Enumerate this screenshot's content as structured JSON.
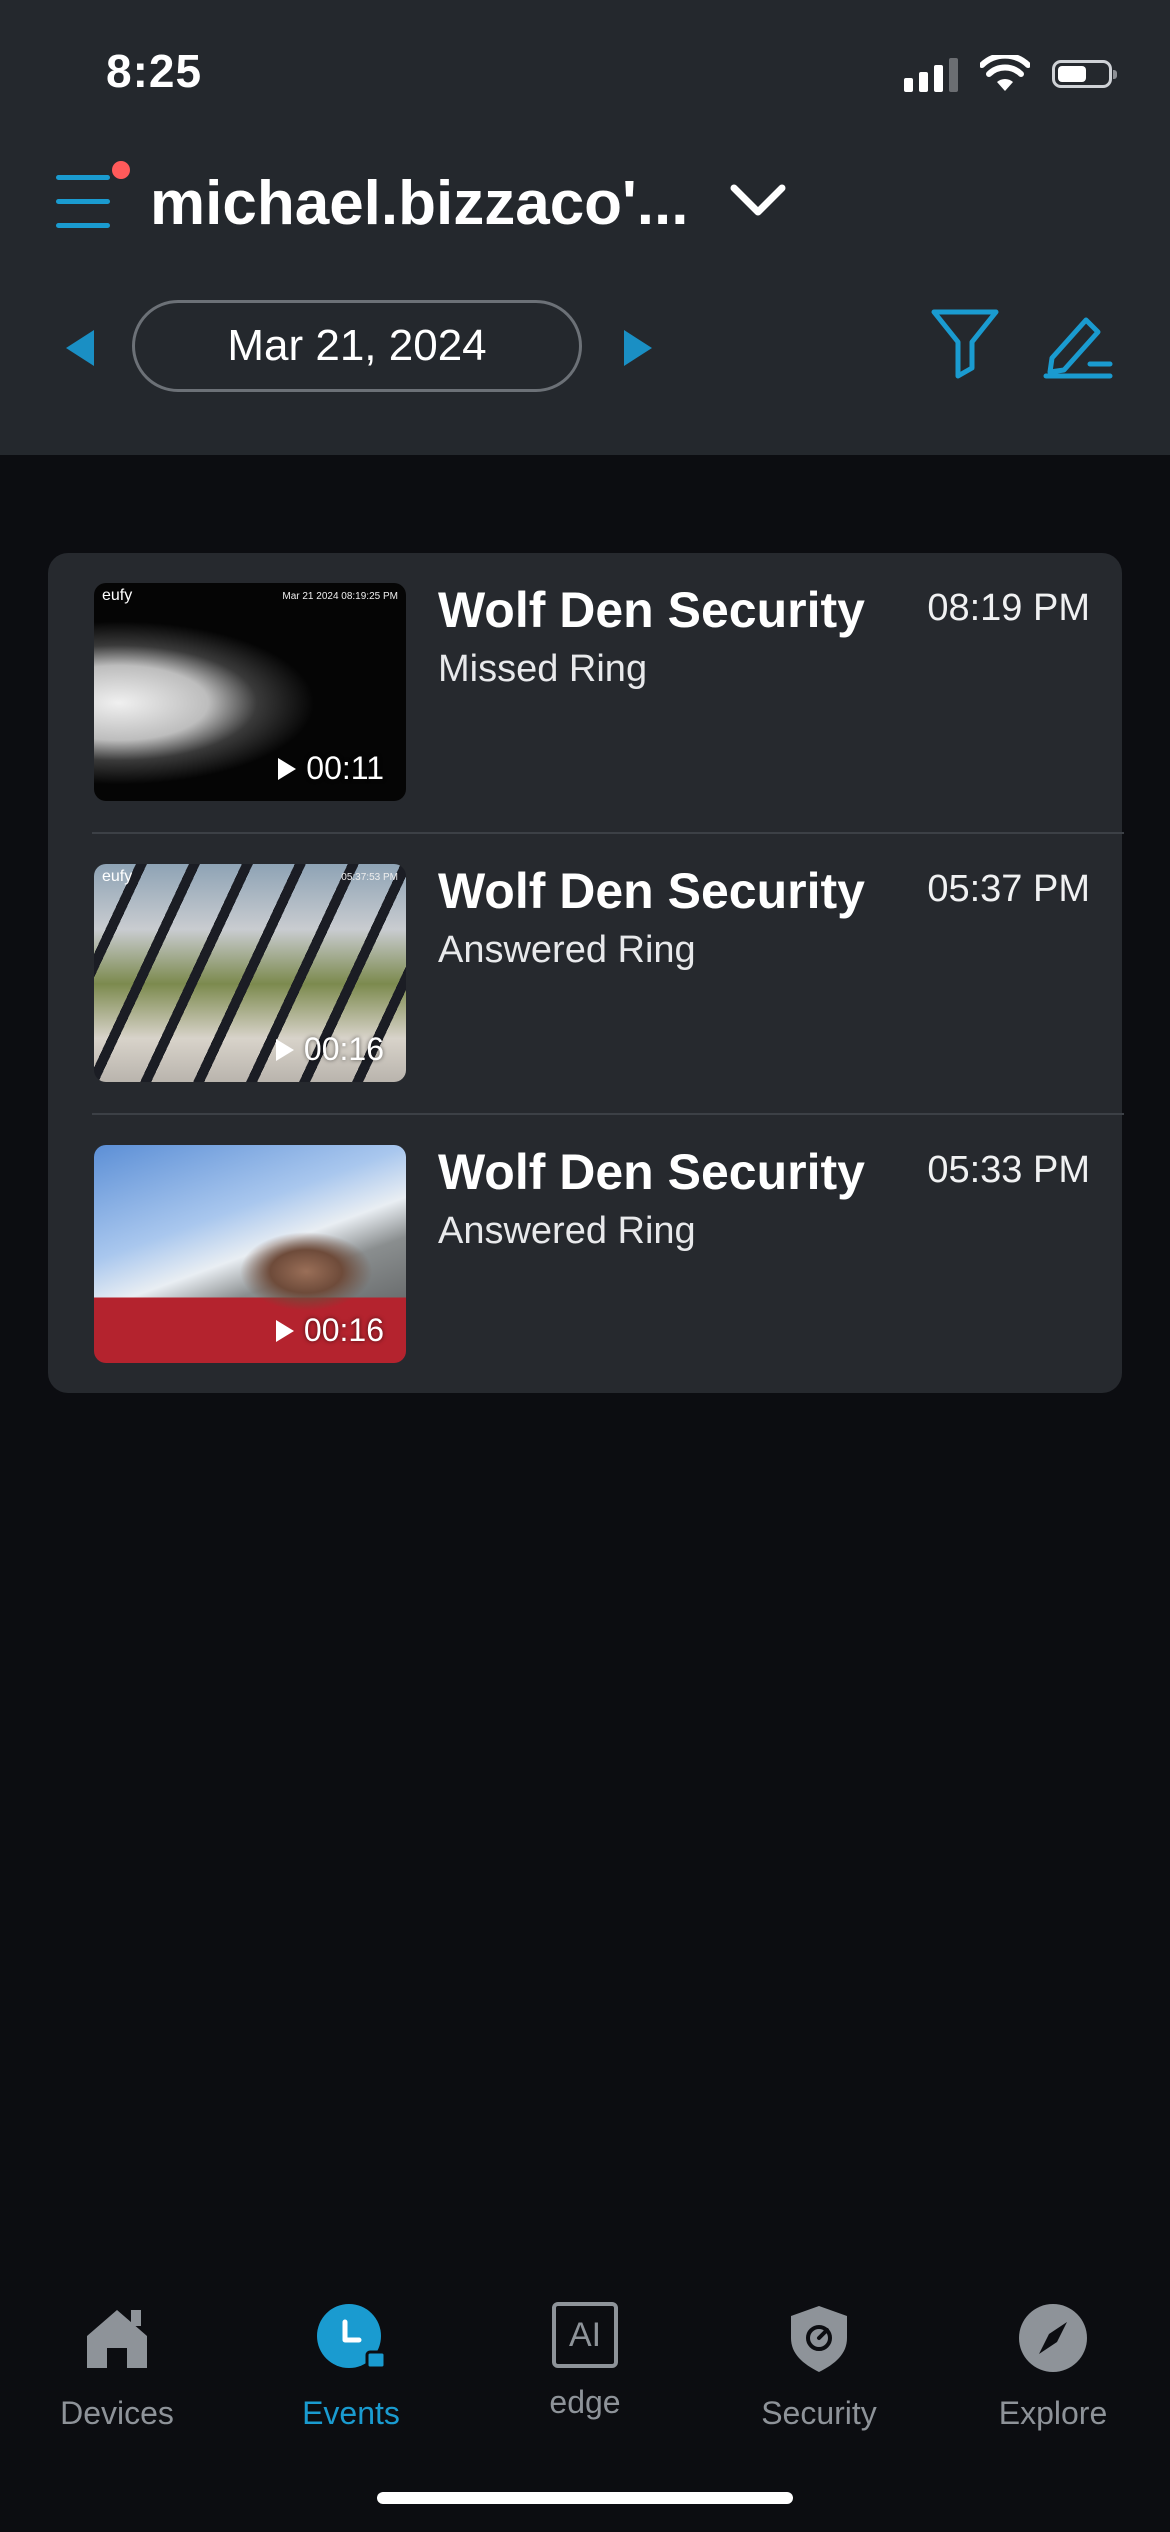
{
  "status_bar": {
    "time": "8:25"
  },
  "header": {
    "account_name": "michael.bizzaco'...",
    "date": "Mar 21, 2024"
  },
  "events": [
    {
      "title": "Wolf Den Security",
      "subtitle": "Missed Ring",
      "time": "08:19 PM",
      "duration": "00:11",
      "thumb_logo": "eufy",
      "thumb_stamp": "Mar 21 2024 08:19:25 PM"
    },
    {
      "title": "Wolf Den Security",
      "subtitle": "Answered Ring",
      "time": "05:37 PM",
      "duration": "00:16",
      "thumb_logo": "eufy",
      "thumb_stamp": "05:37:53 PM"
    },
    {
      "title": "Wolf Den Security",
      "subtitle": "Answered Ring",
      "time": "05:33 PM",
      "duration": "00:16",
      "thumb_logo": "",
      "thumb_stamp": ""
    }
  ],
  "tabs": [
    {
      "label": "Devices",
      "icon": "house-icon"
    },
    {
      "label": "Events",
      "icon": "events-clock-icon"
    },
    {
      "label": "edge",
      "icon": "ai-chip-icon",
      "icon_text": "AI"
    },
    {
      "label": "Security",
      "icon": "shield-icon"
    },
    {
      "label": "Explore",
      "icon": "compass-icon"
    }
  ],
  "colors": {
    "accent": "#1a9bd0",
    "header_bg": "#24282d",
    "page_bg": "#0c0d11",
    "card_bg": "#26292e",
    "notification": "#ff5a5a"
  }
}
